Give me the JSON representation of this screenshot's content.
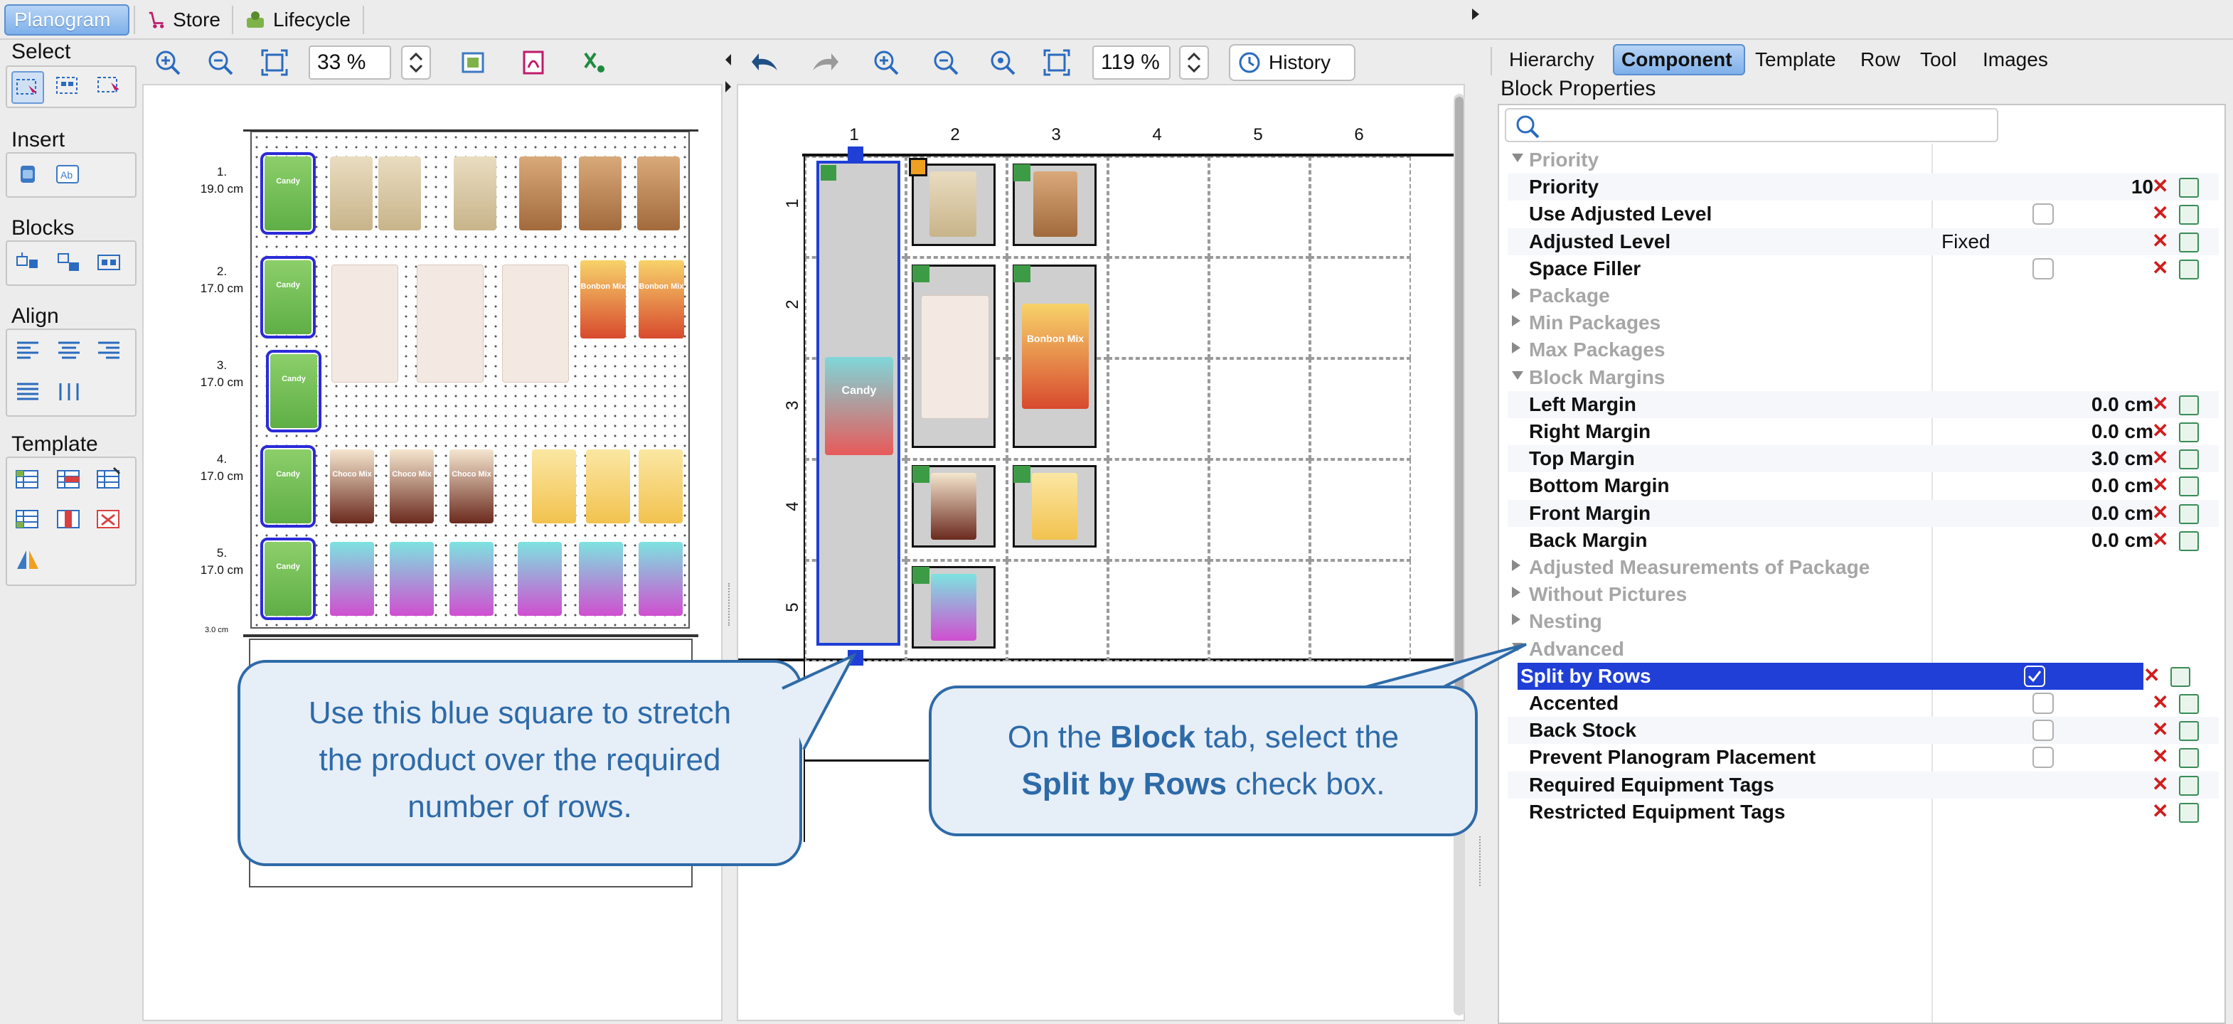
{
  "top_tabs": {
    "planogram": "Planogram",
    "store": "Store",
    "lifecycle": "Lifecycle"
  },
  "left_panel": {
    "select": "Select",
    "insert": "Insert",
    "blocks": "Blocks",
    "align": "Align",
    "template": "Template"
  },
  "left_toolbar": {
    "zoom_value": "33 %"
  },
  "mid_toolbar": {
    "zoom_value": "119 %",
    "history": "History"
  },
  "planogram_rows": [
    {
      "num": "1.",
      "height": "19.0 cm"
    },
    {
      "num": "2.",
      "height": "17.0 cm"
    },
    {
      "num": "3.",
      "height": "17.0 cm"
    },
    {
      "num": "4.",
      "height": "17.0 cm"
    },
    {
      "num": "5.",
      "height": "17.0 cm"
    }
  ],
  "scale_label": "3.0 cm",
  "product_labels": {
    "candy": "Candy",
    "bonbon": "Bonbon Mix",
    "choco": "Choco Mix"
  },
  "grid": {
    "columns": [
      "1",
      "2",
      "3",
      "4",
      "5",
      "6"
    ],
    "rows": [
      "1",
      "2",
      "3",
      "4",
      "5"
    ]
  },
  "right_tabs": [
    "Hierarchy",
    "Component",
    "Template",
    "Row",
    "Tool",
    "Images"
  ],
  "properties": {
    "title": "Block Properties",
    "search_placeholder": "",
    "rows": [
      {
        "name": "Priority",
        "group": true,
        "open": true
      },
      {
        "name": "Priority",
        "value": "10"
      },
      {
        "name": "Use Adjusted Level",
        "check": false
      },
      {
        "name": "Adjusted Level",
        "value": "Fixed"
      },
      {
        "name": "Space Filler",
        "check": false
      },
      {
        "name": "Package",
        "group": true,
        "open": false
      },
      {
        "name": "Min Packages",
        "group": true,
        "open": false
      },
      {
        "name": "Max Packages",
        "group": true,
        "open": false
      },
      {
        "name": "Block Margins",
        "group": true,
        "open": true
      },
      {
        "name": "Left Margin",
        "value": "0.0 cm"
      },
      {
        "name": "Right Margin",
        "value": "0.0 cm"
      },
      {
        "name": "Top Margin",
        "value": "3.0 cm"
      },
      {
        "name": "Bottom Margin",
        "value": "0.0 cm"
      },
      {
        "name": "Front Margin",
        "value": "0.0 cm"
      },
      {
        "name": "Back Margin",
        "value": "0.0 cm"
      },
      {
        "name": "Adjusted Measurements of Package",
        "group": true,
        "open": false
      },
      {
        "name": "Without Pictures",
        "group": true,
        "open": false
      },
      {
        "name": "Nesting",
        "group": true,
        "open": false
      },
      {
        "name": "Advanced",
        "group": true,
        "open": true
      },
      {
        "name": "Split by Rows",
        "check": true,
        "selected": true
      },
      {
        "name": "Accented",
        "check": false
      },
      {
        "name": "Back Stock",
        "check": false
      },
      {
        "name": "Prevent Planogram Placement",
        "check": false
      },
      {
        "name": "Required Equipment Tags"
      },
      {
        "name": "Restricted Equipment Tags"
      }
    ]
  },
  "callouts": {
    "left_line1": "Use this blue square to stretch",
    "left_line2": "the product over the required",
    "left_line3": "number of rows.",
    "right_pre": "On the ",
    "right_bold1": "Block",
    "right_mid": " tab, select the",
    "right_bold2": "Split by Rows",
    "right_post": " check box."
  },
  "colors": {
    "accent": "#2e6aa8",
    "selection": "#1f3fd6",
    "green_marker": "#3d9b46",
    "orange_marker": "#f0a020"
  }
}
